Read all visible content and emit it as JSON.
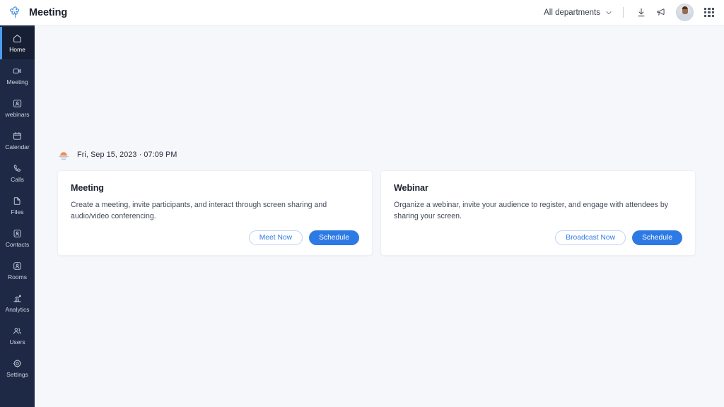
{
  "app": {
    "logo_icon": "flower-cross-logo-icon",
    "title": "Meeting"
  },
  "topbar": {
    "department_selector": {
      "label": "All departments",
      "chevron_icon": "chevron-down-icon"
    },
    "download_icon": "download-icon",
    "announcement_icon": "megaphone-icon",
    "avatar_icon": "user-avatar",
    "apps_icon": "apps-grid-icon"
  },
  "sidebar": {
    "items": [
      {
        "label": "Home",
        "icon": "home-icon",
        "active": true
      },
      {
        "label": "Meeting",
        "icon": "video-camera-icon",
        "active": false
      },
      {
        "label": "webinars",
        "icon": "webinar-user-icon",
        "active": false
      },
      {
        "label": "Calendar",
        "icon": "calendar-icon",
        "active": false
      },
      {
        "label": "Calls",
        "icon": "phone-icon",
        "active": false
      },
      {
        "label": "Files",
        "icon": "file-icon",
        "active": false
      },
      {
        "label": "Contacts",
        "icon": "contact-card-icon",
        "active": false
      },
      {
        "label": "Rooms",
        "icon": "rooms-user-icon",
        "active": false
      },
      {
        "label": "Analytics",
        "icon": "bar-chart-trend-icon",
        "active": false
      },
      {
        "label": "Users",
        "icon": "users-group-icon",
        "active": false
      },
      {
        "label": "Settings",
        "icon": "gear-icon",
        "active": false
      }
    ]
  },
  "main": {
    "datetime": {
      "icon": "sunset-icon",
      "text": "Fri, Sep 15, 2023  ·  07:09 PM"
    },
    "cards": [
      {
        "id": "meeting",
        "title": "Meeting",
        "description": "Create a meeting, invite participants, and interact through screen sharing and audio/video conferencing.",
        "secondary_button": "Meet Now",
        "primary_button": "Schedule"
      },
      {
        "id": "webinar",
        "title": "Webinar",
        "description": "Organize a webinar, invite your audience to register, and engage with attendees by sharing your screen.",
        "secondary_button": "Broadcast Now",
        "primary_button": "Schedule"
      }
    ]
  },
  "colors": {
    "accent_blue": "#2d7ae5",
    "sidebar_bg": "#1e2a45",
    "sidebar_active_bg": "#161f33",
    "active_indicator": "#4c9df0",
    "page_bg": "#f6f7fb",
    "card_bg": "#ffffff",
    "sunset_orange": "#ef8a5a"
  }
}
